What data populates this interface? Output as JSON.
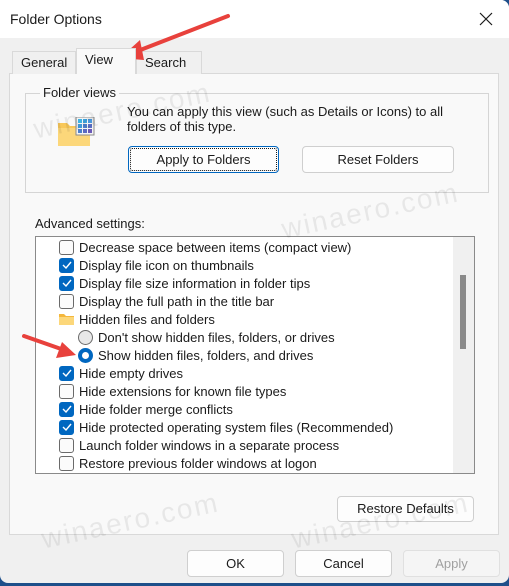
{
  "window": {
    "title": "Folder Options"
  },
  "tabs": [
    {
      "label": "General",
      "active": false
    },
    {
      "label": "View",
      "active": true
    },
    {
      "label": "Search",
      "active": false
    }
  ],
  "folder_views": {
    "legend": "Folder views",
    "description": "You can apply this view (such as Details or Icons) to all folders of this type.",
    "apply_button": "Apply to Folders",
    "reset_button": "Reset Folders"
  },
  "advanced": {
    "label": "Advanced settings:",
    "items": [
      {
        "type": "checkbox",
        "label": "Decrease space between items (compact view)",
        "checked": false,
        "indent": 1
      },
      {
        "type": "checkbox",
        "label": "Display file icon on thumbnails",
        "checked": true,
        "indent": 1
      },
      {
        "type": "checkbox",
        "label": "Display file size information in folder tips",
        "checked": true,
        "indent": 1
      },
      {
        "type": "checkbox",
        "label": "Display the full path in the title bar",
        "checked": false,
        "indent": 1
      },
      {
        "type": "folder",
        "label": "Hidden files and folders",
        "indent": 1
      },
      {
        "type": "radio",
        "label": "Don't show hidden files, folders, or drives",
        "checked": false,
        "indent": 2
      },
      {
        "type": "radio",
        "label": "Show hidden files, folders, and drives",
        "checked": true,
        "indent": 2
      },
      {
        "type": "checkbox",
        "label": "Hide empty drives",
        "checked": true,
        "indent": 1
      },
      {
        "type": "checkbox",
        "label": "Hide extensions for known file types",
        "checked": false,
        "indent": 1
      },
      {
        "type": "checkbox",
        "label": "Hide folder merge conflicts",
        "checked": true,
        "indent": 1
      },
      {
        "type": "checkbox",
        "label": "Hide protected operating system files (Recommended)",
        "checked": true,
        "indent": 1
      },
      {
        "type": "checkbox",
        "label": "Launch folder windows in a separate process",
        "checked": false,
        "indent": 1
      },
      {
        "type": "checkbox",
        "label": "Restore previous folder windows at logon",
        "checked": false,
        "indent": 1
      }
    ],
    "restore_defaults_button": "Restore Defaults"
  },
  "footer": {
    "ok_button": "OK",
    "cancel_button": "Cancel",
    "apply_button": "Apply"
  },
  "watermark": "winaero.com",
  "colors": {
    "accent": "#0067c0",
    "annotation_arrow": "#e8413c"
  }
}
